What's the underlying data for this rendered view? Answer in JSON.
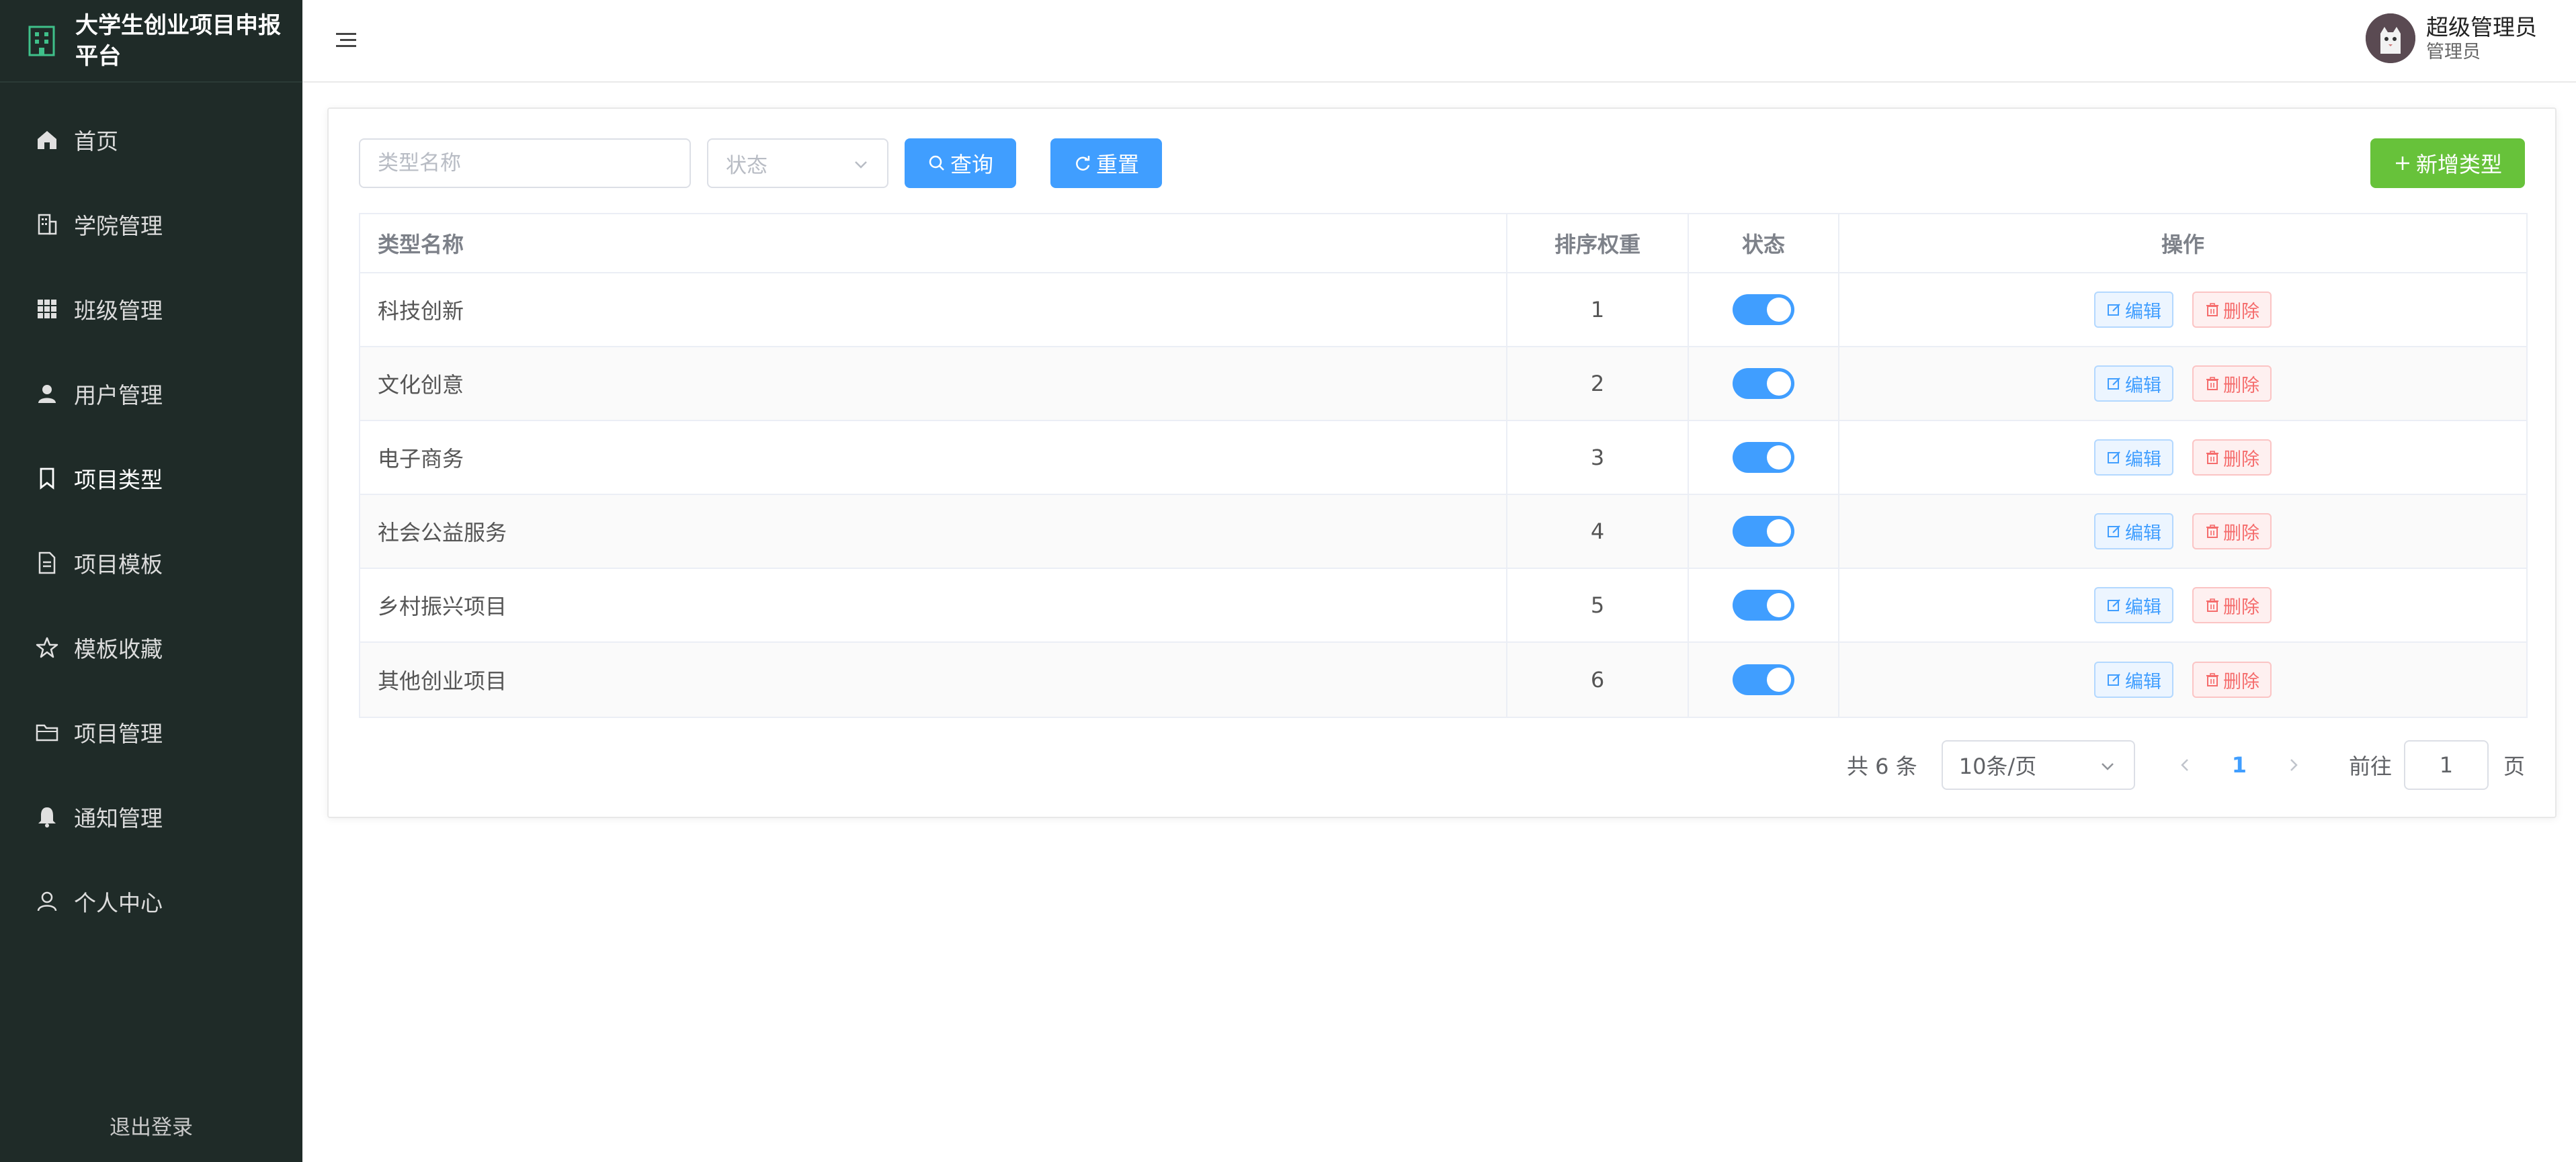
{
  "app": {
    "title": "大学生创业项目申报平台"
  },
  "colors": {
    "sidebar_bg": "#1f2b28",
    "primary": "#409eff",
    "success": "#67c23a",
    "danger": "#f56c6c",
    "brand_icon": "#3fc08a"
  },
  "sidebar": {
    "items": [
      {
        "label": "首页",
        "icon": "home-icon"
      },
      {
        "label": "学院管理",
        "icon": "building-icon"
      },
      {
        "label": "班级管理",
        "icon": "grid-icon"
      },
      {
        "label": "用户管理",
        "icon": "user-icon"
      },
      {
        "label": "项目类型",
        "icon": "bookmark-icon",
        "active": true
      },
      {
        "label": "项目模板",
        "icon": "document-icon"
      },
      {
        "label": "模板收藏",
        "icon": "star-icon"
      },
      {
        "label": "项目管理",
        "icon": "folder-icon"
      },
      {
        "label": "通知管理",
        "icon": "bell-icon"
      },
      {
        "label": "个人中心",
        "icon": "person-icon"
      }
    ],
    "logout": "退出登录"
  },
  "header": {
    "user_name": "超级管理员",
    "user_role": "管理员"
  },
  "filters": {
    "name_placeholder": "类型名称",
    "status_placeholder": "状态",
    "search_label": "查询",
    "reset_label": "重置",
    "add_label": "新增类型"
  },
  "table": {
    "columns": [
      "类型名称",
      "排序权重",
      "状态",
      "操作"
    ],
    "rows": [
      {
        "name": "科技创新",
        "weight": "1",
        "enabled": true
      },
      {
        "name": "文化创意",
        "weight": "2",
        "enabled": true
      },
      {
        "name": "电子商务",
        "weight": "3",
        "enabled": true
      },
      {
        "name": "社会公益服务",
        "weight": "4",
        "enabled": true
      },
      {
        "name": "乡村振兴项目",
        "weight": "5",
        "enabled": true
      },
      {
        "name": "其他创业项目",
        "weight": "6",
        "enabled": true
      }
    ],
    "edit_label": "编辑",
    "delete_label": "删除"
  },
  "pagination": {
    "total_text": "共 6 条",
    "page_size": "10条/页",
    "current_page": "1",
    "goto_label": "前往",
    "goto_value": "1",
    "unit": "页"
  }
}
